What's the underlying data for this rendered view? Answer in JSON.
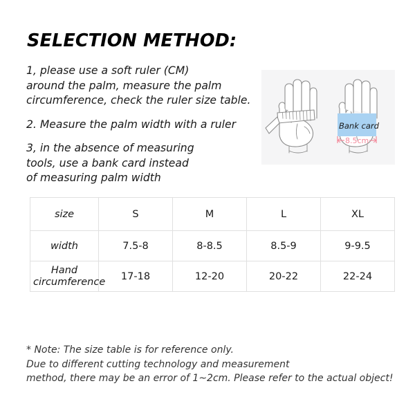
{
  "page": {
    "background_color": "#ffffff",
    "title": "SELECTION METHOD:"
  },
  "instructions": [
    {
      "id": "step-1",
      "lines": [
        "1, please use a soft ruler (CM)",
        "around the palm, measure the palm",
        "circumference, check the ruler size table."
      ]
    },
    {
      "id": "step-2",
      "lines": [
        "2. Measure the palm width with a ruler"
      ]
    },
    {
      "id": "step-3",
      "lines": [
        "3, in the absence of measuring",
        "tools, use a bank card instead",
        "of measuring palm width"
      ]
    }
  ],
  "illustration": {
    "background_color": "#f5f5f6",
    "hand_outline_color": "#8c8c8c",
    "left_panel": {
      "name": "hand-with-tape-measure",
      "ruler_fill": "#ffffff",
      "ruler_stroke": "#8c8c8c"
    },
    "right_panel": {
      "name": "hand-with-bank-card",
      "card_label": "Bank card",
      "card_color": "#a9d2f2",
      "dimension_label": "8.5cm",
      "dimension_color": "#f4889a"
    }
  },
  "size_table": {
    "header": [
      "size",
      "S",
      "M",
      "L",
      "XL"
    ],
    "rows": [
      {
        "label": "width",
        "values": [
          "7.5-8",
          "8-8.5",
          "8.5-9",
          "9-9.5"
        ]
      },
      {
        "label": "Hand circumference",
        "values": [
          "17-18",
          "12-20",
          "20-22",
          "22-24"
        ]
      }
    ],
    "border_color": "#e0e0e0"
  },
  "note": {
    "lines": [
      "* Note: The size table is for reference only.",
      "Due to different cutting technology and measurement",
      "method, there may be an error of 1~2cm. Please refer to the actual object!"
    ]
  }
}
